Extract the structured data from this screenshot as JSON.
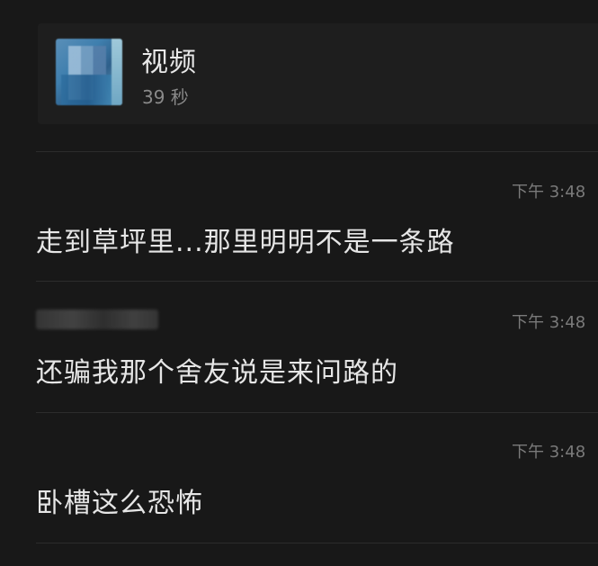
{
  "video": {
    "title": "视频",
    "duration": "39 秒",
    "thumbnail_icon": "blurred-video-thumbnail"
  },
  "messages": [
    {
      "time": "下午 3:48",
      "text": "走到草坪里...那里明明不是一条路"
    },
    {
      "time": "下午 3:48",
      "text": "还骗我那个舍友说是来问路的"
    },
    {
      "time": "下午 3:48",
      "text": "卧槽这么恐怖"
    }
  ]
}
